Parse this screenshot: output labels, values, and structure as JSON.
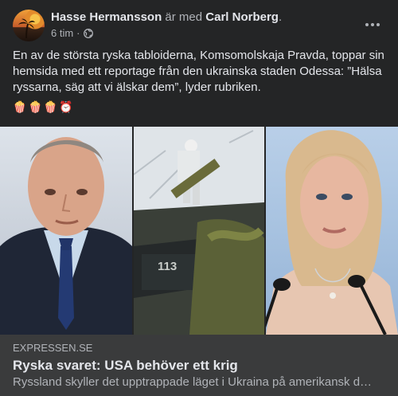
{
  "post": {
    "author": "Hasse Hermansson",
    "with_text": " är med ",
    "tagged": "Carl Norberg",
    "period": ".",
    "time": "6 tim",
    "separator": "·",
    "audience_icon": "globe-icon",
    "more_icon": "more-options-icon",
    "text": "En av de största ryska tabloiderna, Komsomolskaja Pravda, toppar sin hemsida med ett reportage från den ukrainska staden Odessa: ”Hälsa ryssarna, säg att vi älskar dem”, lyder rubriken.",
    "emojis": [
      "🍿",
      "🍿",
      "🍿",
      "⏰"
    ]
  },
  "image": {
    "vehicle_number": "113"
  },
  "link_card": {
    "domain": "EXPRESSEN.SE",
    "title": "Ryska svaret: USA behöver ett krig",
    "description": "Ryssland skyller det upptrappade läget i Ukraina på amerikansk d…"
  },
  "colors": {
    "background": "#242526",
    "card": "#3a3b3c",
    "text_primary": "#e4e6eb",
    "text_secondary": "#b0b3b8"
  }
}
